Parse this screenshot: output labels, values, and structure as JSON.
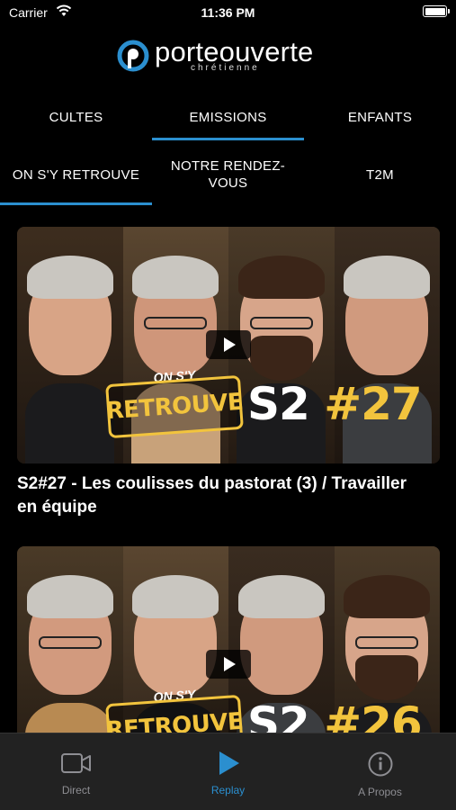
{
  "status_bar": {
    "carrier": "Carrier",
    "time": "11:36 PM"
  },
  "logo": {
    "name": "porteouverte",
    "subtitle": "chrétienne"
  },
  "tabs": [
    {
      "label": "CULTES",
      "active": false
    },
    {
      "label": "EMISSIONS",
      "active": true
    },
    {
      "label": "ENFANTS",
      "active": false
    }
  ],
  "subtabs": [
    {
      "label": "ON S'Y RETROUVE",
      "active": true
    },
    {
      "label": "NOTRE RENDEZ-VOUS",
      "active": false
    },
    {
      "label": "T2M",
      "active": false
    }
  ],
  "videos": [
    {
      "title": "S2#27 - Les coulisses du pastorat (3) / Travailler en équipe",
      "thumbnail": {
        "badge_small": "ON S'Y",
        "badge": "RETROUVE",
        "season": "S2",
        "episode": "#27"
      }
    },
    {
      "title": "",
      "thumbnail": {
        "badge_small": "ON S'Y",
        "badge": "RETROUVE",
        "season": "S2",
        "episode": "#26"
      }
    }
  ],
  "bottom_nav": [
    {
      "label": "Direct",
      "icon": "video-camera-icon",
      "active": false
    },
    {
      "label": "Replay",
      "icon": "play-icon",
      "active": true
    },
    {
      "label": "A Propos",
      "icon": "info-icon",
      "active": false
    }
  ],
  "colors": {
    "accent": "#2b8fcf",
    "badge_yellow": "#f2c43d",
    "background": "#000000",
    "tab_bar": "#222222"
  }
}
